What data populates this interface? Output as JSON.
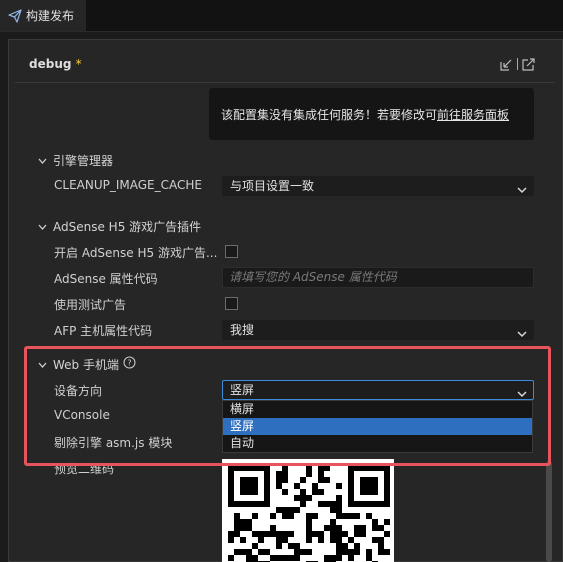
{
  "window": {
    "tab_title": "构建发布"
  },
  "profile": {
    "name": "debug",
    "modified_mark": "*"
  },
  "notice": {
    "text": "该配置集没有集成任何服务！若要修改可",
    "link": "前往服务面板"
  },
  "engine_manager": {
    "title": "引擎管理器",
    "rows": [
      {
        "label": "CLEANUP_IMAGE_CACHE",
        "value": "与项目设置一致"
      }
    ]
  },
  "adsense": {
    "title": "AdSense H5 游戏广告插件",
    "enable_label": "开启 AdSense H5 游戏广告...",
    "enable_checked": false,
    "property_label": "AdSense 属性代码",
    "property_placeholder": "请填写您的 AdSense 属性代码",
    "test_ads_label": "使用测试广告",
    "test_ads_checked": false,
    "afp_label": "AFP 主机属性代码",
    "afp_value": "我搜"
  },
  "web_mobile": {
    "title": "Web 手机端",
    "orientation_label": "设备方向",
    "orientation_value": "竖屏",
    "orientation_options": [
      "横屏",
      "竖屏",
      "自动"
    ],
    "orientation_selected_index": 1,
    "vconsole_label": "VConsole",
    "remove_asmjs_label": "剔除引擎 asm.js 模块",
    "qrcode_label": "预览二维码"
  },
  "icons": {
    "tab": "send-icon",
    "close": "close-icon",
    "import": "import-icon",
    "export": "export-icon",
    "collapse": "chevron-down-icon",
    "help": "help-icon"
  },
  "colors": {
    "accent": "#2f6fbf",
    "highlight": "#e8545b",
    "modified": "#ffcf3f"
  }
}
